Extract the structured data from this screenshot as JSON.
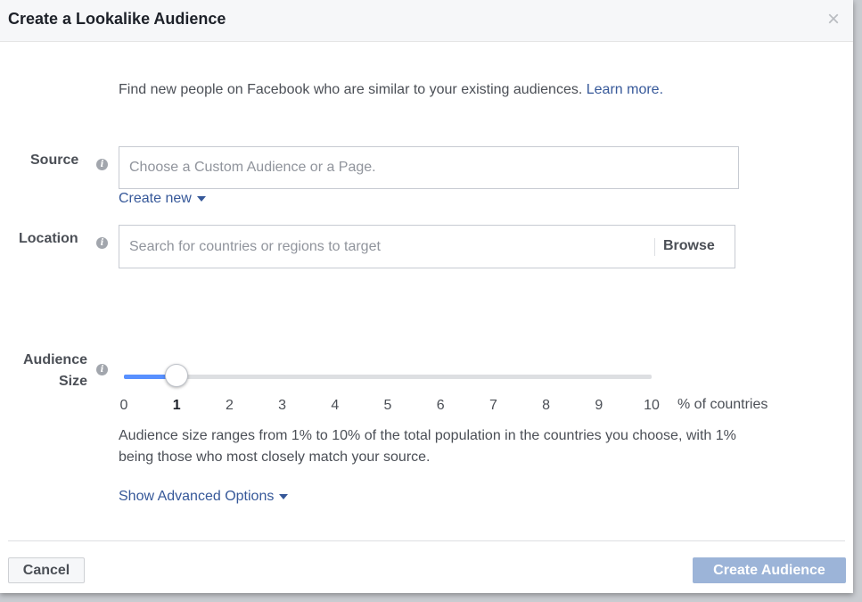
{
  "dialog": {
    "title": "Create a Lookalike Audience",
    "close_symbol": "×"
  },
  "intro": {
    "text": "Find new people on Facebook who are similar to your existing audiences.",
    "link": "Learn more."
  },
  "source": {
    "label": "Source",
    "placeholder": "Choose a Custom Audience or a Page.",
    "value": "",
    "create_new": "Create new"
  },
  "location": {
    "label": "Location",
    "placeholder": "Search for countries or regions to target",
    "value": "",
    "browse": "Browse"
  },
  "audience_size": {
    "label_line1": "Audience",
    "label_line2": "Size",
    "value": 1,
    "min": 0,
    "max": 10,
    "ticks": [
      "0",
      "1",
      "2",
      "3",
      "4",
      "5",
      "6",
      "7",
      "8",
      "9",
      "10"
    ],
    "unit": "% of countries",
    "description": "Audience size ranges from 1% to 10% of the total population in the countries you choose, with 1% being those who most closely match your source."
  },
  "advanced_options": "Show Advanced Options",
  "footer": {
    "cancel": "Cancel",
    "create": "Create Audience"
  },
  "icons": {
    "info": "info-icon",
    "close": "close-icon",
    "caret": "caret-down-icon"
  },
  "colors": {
    "link": "#365899",
    "slider_fill": "#5890ff",
    "primary_disabled": "#9cb4d8"
  }
}
